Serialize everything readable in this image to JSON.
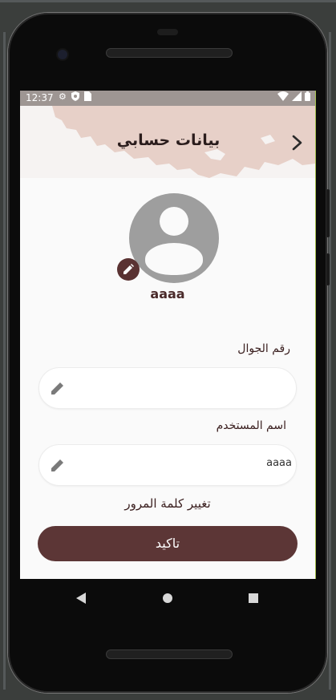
{
  "status_bar": {
    "time": "12:37",
    "left_icons": [
      "gear-icon",
      "shield-icon",
      "sim-icon"
    ],
    "right_icons": [
      "wifi-icon",
      "signal-icon",
      "battery-icon"
    ]
  },
  "header": {
    "title": "بيانات حسابي",
    "back_icon": "chevron-right-icon",
    "accent_color": "#e7d0c8"
  },
  "profile": {
    "username": "aaaa",
    "avatar_icon": "person-icon",
    "edit_icon": "pencil-icon",
    "edit_color": "#5a3232"
  },
  "form": {
    "phone": {
      "label": "رقم الجوال",
      "value": ""
    },
    "username": {
      "label": "اسم المستخدم",
      "value": "aaaa"
    },
    "change_password": "تغيير كلمة المرور",
    "confirm": "تاكيد",
    "button_color": "#5c3636"
  },
  "nav": {
    "icons": [
      "back-triangle-icon",
      "home-circle-icon",
      "recents-square-icon"
    ]
  }
}
